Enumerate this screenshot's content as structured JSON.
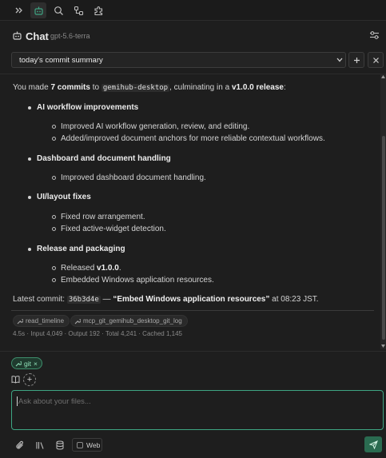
{
  "toolbar": {
    "icons": [
      "chevrons-right-icon",
      "bot-icon",
      "search-icon",
      "git-branch-icon",
      "puzzle-icon"
    ]
  },
  "header": {
    "title": "Chat",
    "model": "gpt-5.6-terra"
  },
  "session": {
    "selected": "today's commit summary",
    "new_label": "+",
    "close_label": "×"
  },
  "message": {
    "intro_1": "You made ",
    "intro_count": "7 commits",
    "intro_2": " to ",
    "intro_repo": "gemihub-desktop",
    "intro_3": ", culminating in a ",
    "intro_release": "v1.0.0 release",
    "intro_4": ":",
    "sections": [
      {
        "heading": "AI workflow improvements",
        "items": [
          "Improved AI workflow generation, review, and editing.",
          "Added/improved document anchors for more reliable contextual workflows."
        ]
      },
      {
        "heading": "Dashboard and document handling",
        "items": [
          "Improved dashboard document handling."
        ]
      },
      {
        "heading": "UI/layout fixes",
        "items": [
          "Fixed row arrangement.",
          "Fixed active-widget detection."
        ]
      },
      {
        "heading": "Release and packaging",
        "items": [
          "Released ",
          "Embedded Windows application resources."
        ],
        "release_version": "v1.0.0",
        "release_period": "."
      }
    ],
    "latest_prefix": "Latest commit: ",
    "latest_hash": "36b3d4e",
    "latest_dash": " — ",
    "latest_title": "“Embed Windows application resources”",
    "latest_suffix": " at 08:23 JST.",
    "tools": [
      "read_timeline",
      "mcp_git_gemihub_desktop_git_log"
    ],
    "stats": "4.5s · Input 4,049 · Output 192 · Total 4,241 · Cached 1,145"
  },
  "composer": {
    "chip_label": "git",
    "chip_close": "×",
    "add_label": "+",
    "placeholder": "Ask about your files...",
    "web_label": "Web"
  },
  "colors": {
    "accent": "#3ea583",
    "send_bg": "#2a6b50",
    "background": "#1e1e1e"
  }
}
